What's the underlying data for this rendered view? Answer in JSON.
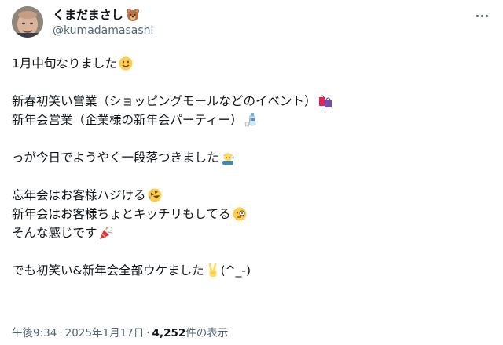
{
  "author": {
    "display_name": "くまだまさし",
    "handle": "@kumadamasashi",
    "name_emoji": "bear-face-icon",
    "avatar": "avatar"
  },
  "post": {
    "lines": [
      {
        "text": "1月中旬なりました",
        "emoji": "smiling-face-icon"
      },
      {
        "text": "",
        "emoji": null
      },
      {
        "text": "新春初笑い営業（ショッピングモールなどのイベント）",
        "emoji": "shopping-bags-icon"
      },
      {
        "text": "新年会営業（企業様の新年会パーティー）",
        "emoji": "sake-icon"
      },
      {
        "text": "",
        "emoji": null
      },
      {
        "text": "っが今日でようやく一段落つきました",
        "emoji": "sweating-worker-icon"
      },
      {
        "text": "",
        "emoji": null
      },
      {
        "text": "忘年会はお客様ハジける",
        "emoji": "rolling-laughing-icon"
      },
      {
        "text": "新年会はお客様ちょとキッチリもしてる",
        "emoji": "monocle-face-icon"
      },
      {
        "text": "そんな感じです",
        "emoji": "party-popper-icon"
      },
      {
        "text": "",
        "emoji": null
      },
      {
        "text": "でも初笑い&新年会全部ウケました",
        "emoji": "victory-hand-icon",
        "suffix": "(^_-)"
      }
    ]
  },
  "meta": {
    "time": "午後9:34",
    "separator": "·",
    "date": "2025年1月17日",
    "views_count": "4,252",
    "views_label": " 件の表示"
  },
  "colors": {
    "text": "#0f1419",
    "secondary": "#536471"
  }
}
